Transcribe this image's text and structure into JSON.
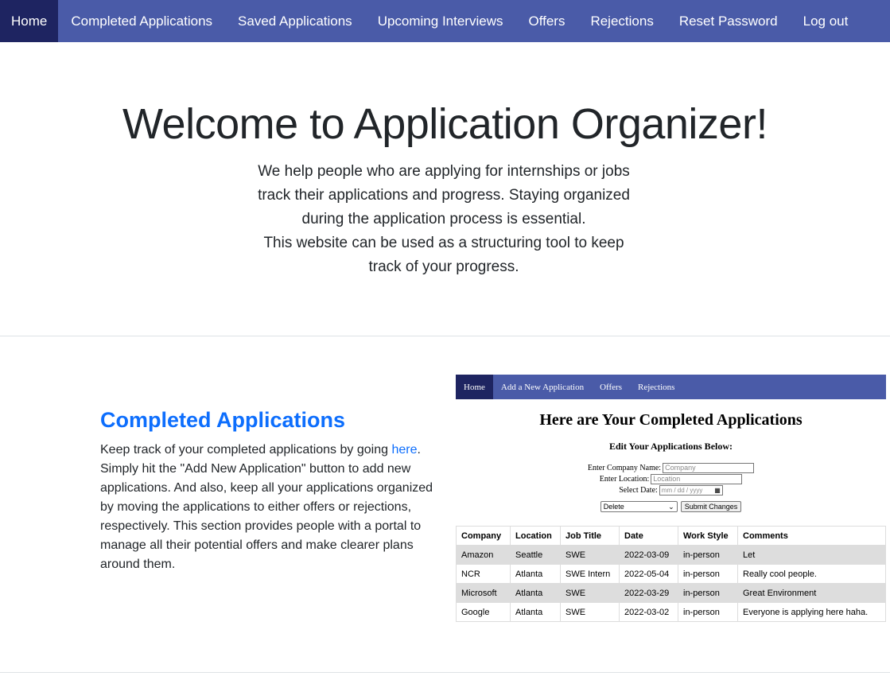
{
  "nav": {
    "items": [
      {
        "label": "Home"
      },
      {
        "label": "Completed Applications"
      },
      {
        "label": "Saved Applications"
      },
      {
        "label": "Upcoming Interviews"
      },
      {
        "label": "Offers"
      },
      {
        "label": "Rejections"
      },
      {
        "label": "Reset Password"
      },
      {
        "label": "Log out"
      }
    ]
  },
  "hero": {
    "title": "Welcome to Application Organizer!",
    "lines": [
      "We help people who are applying for internships or jobs",
      "track their applications and progress. Staying organized",
      "during the application process is essential.",
      "This website can be used as a structuring tool to keep",
      "track of your progress."
    ]
  },
  "section": {
    "title": "Completed Applications",
    "text_before_link": "Keep track of your completed applications by going ",
    "link_text": "here",
    "text_after_link": ". Simply hit the \"Add New Application\" button to add new applications. And also, keep all your applications organized by moving the applications to either offers or rejections, respectively. This section provides people with a portal to manage all their potential offers and make clearer plans around them."
  },
  "preview": {
    "nav": [
      "Home",
      "Add a New Application",
      "Offers",
      "Rejections"
    ],
    "title": "Here are Your Completed Applications",
    "subtitle": "Edit Your Applications Below:",
    "company_label": "Enter Company Name:",
    "company_placeholder": "Company",
    "location_label": "Enter Location:",
    "location_placeholder": "Location",
    "date_label": "Select Date:",
    "date_placeholder": "mm / dd / yyyy",
    "select_value": "Delete",
    "submit_label": "Submit Changes",
    "table": {
      "headers": [
        "Company",
        "Location",
        "Job Title",
        "Date",
        "Work Style",
        "Comments"
      ],
      "rows": [
        [
          "Amazon",
          "Seattle",
          "SWE",
          "2022-03-09",
          "in-person",
          "Let"
        ],
        [
          "NCR",
          "Atlanta",
          "SWE Intern",
          "2022-05-04",
          "in-person",
          "Really cool people."
        ],
        [
          "Microsoft",
          "Atlanta",
          "SWE",
          "2022-03-29",
          "in-person",
          "Great Environment"
        ],
        [
          "Google",
          "Atlanta",
          "SWE",
          "2022-03-02",
          "in-person",
          "Everyone is applying here haha."
        ]
      ]
    }
  },
  "colors": {
    "nav_bg": "#4a5ba8",
    "nav_active": "#1e2461",
    "link": "#0d6efd"
  }
}
